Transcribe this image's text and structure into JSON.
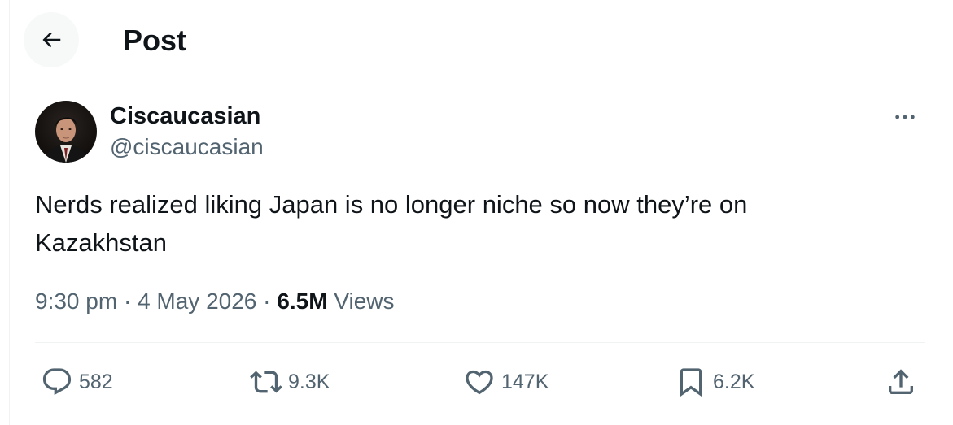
{
  "header": {
    "title": "Post",
    "back_icon": "arrow-left-icon"
  },
  "author": {
    "display_name": "Ciscaucasian",
    "handle": "@ciscaucasian",
    "avatar_icon": "profile-photo"
  },
  "post": {
    "text": "Nerds realized liking Japan is no longer niche so now they’re on\nKazakhstan",
    "time": "9:30 pm",
    "date": "4 May 2026",
    "separator": "·",
    "views_count": "6.5M",
    "views_label": "Views"
  },
  "actions": {
    "replies": "582",
    "reposts": "9.3K",
    "likes": "147K",
    "bookmarks": "6.2K"
  },
  "colors": {
    "text_primary": "#0f1419",
    "text_secondary": "#536471",
    "border": "#eff3f4"
  }
}
